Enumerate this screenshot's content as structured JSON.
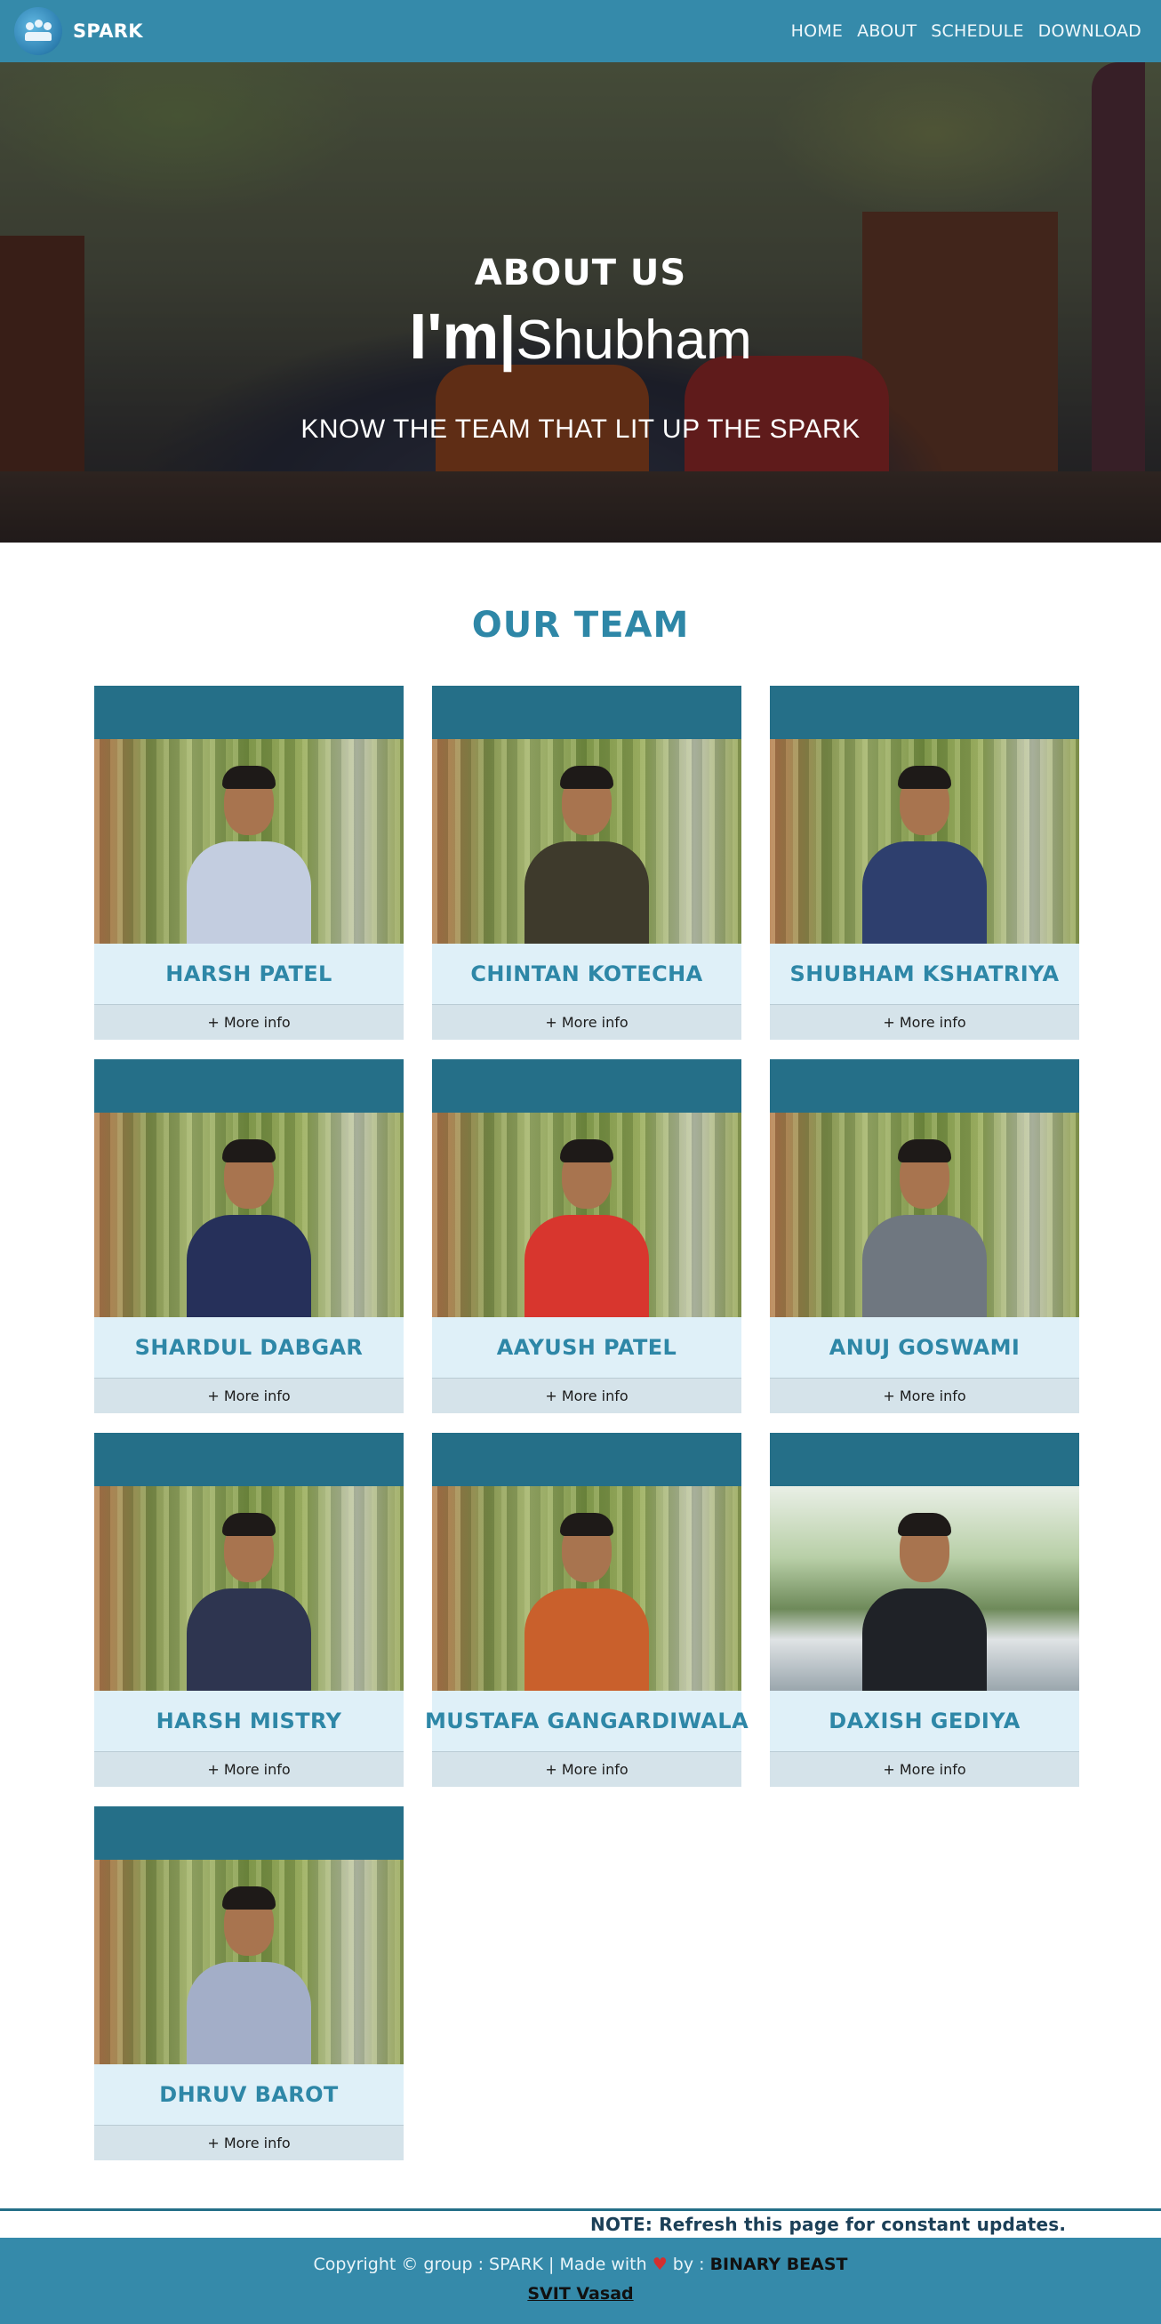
{
  "navbar": {
    "brand": "SPARK",
    "links": [
      "HOME",
      "ABOUT",
      "SCHEDULE",
      "DOWNLOAD"
    ]
  },
  "hero": {
    "title": "ABOUT US",
    "typed_prefix": "I'm",
    "typed_cursor": "|",
    "typed_word": "Shubham",
    "subtitle": "KNOW THE TEAM THAT LIT UP THE SPARK"
  },
  "team": {
    "heading": "OUR TEAM",
    "more_label": "+ More info",
    "members": [
      {
        "name": "HARSH PATEL",
        "shirt": "#c3cde0"
      },
      {
        "name": "CHINTAN KOTECHA",
        "shirt": "#3e3a2c"
      },
      {
        "name": "SHUBHAM KSHATRIYA",
        "shirt": "#2e3f6e"
      },
      {
        "name": "SHARDUL DABGAR",
        "shirt": "#26305a"
      },
      {
        "name": "AAYUSH PATEL",
        "shirt": "#d8362e"
      },
      {
        "name": "ANUJ GOSWAMI",
        "shirt": "#6f7780"
      },
      {
        "name": "HARSH MISTRY",
        "shirt": "#2e3550"
      },
      {
        "name": "MUSTAFA GANGARDIWALA",
        "shirt": "#c9602c"
      },
      {
        "name": "DAXISH GEDIYA",
        "shirt": "#1f2227"
      },
      {
        "name": "DHRUV BAROT",
        "shirt": "#a3aec8"
      }
    ]
  },
  "note": "NOTE: Refresh this page for constant updates.",
  "footer": {
    "copyright": "Copyright © group : SPARK | Made with",
    "heart": "♥",
    "by": "by :",
    "team": "BINARY BEAST",
    "college": "SVIT Vasad"
  }
}
